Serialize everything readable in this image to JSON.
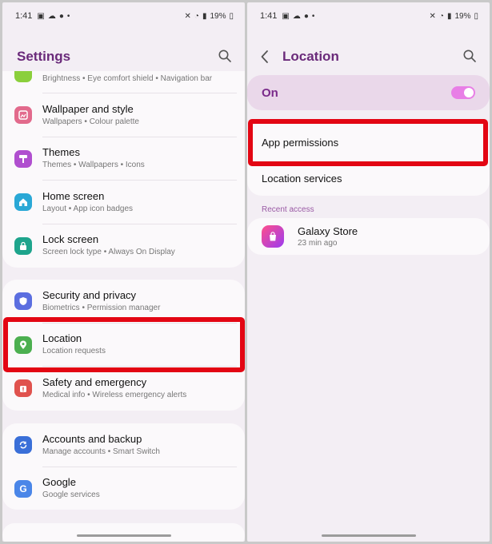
{
  "status": {
    "time": "1:41",
    "battery": "19%"
  },
  "left": {
    "title": "Settings",
    "partial_item": {
      "sub": "Brightness  •  Eye comfort shield  •  Navigation bar"
    },
    "group1": [
      {
        "label": "Wallpaper and style",
        "sub": "Wallpapers  •  Colour palette",
        "icon": "wallpaper-icon",
        "color": "#e26a8c"
      },
      {
        "label": "Themes",
        "sub": "Themes  •  Wallpapers  •  Icons",
        "icon": "themes-icon",
        "color": "#b04fcf"
      },
      {
        "label": "Home screen",
        "sub": "Layout  •  App icon badges",
        "icon": "home-icon",
        "color": "#2aa8d6"
      },
      {
        "label": "Lock screen",
        "sub": "Screen lock type  •  Always On Display",
        "icon": "lock-icon",
        "color": "#1ea48c"
      }
    ],
    "group2": [
      {
        "label": "Security and privacy",
        "sub": "Biometrics  •  Permission manager",
        "icon": "shield-icon",
        "color": "#5b6ee0"
      },
      {
        "label": "Location",
        "sub": "Location requests",
        "icon": "location-pin-icon",
        "color": "#4caf50"
      },
      {
        "label": "Safety and emergency",
        "sub": "Medical info  •  Wireless emergency alerts",
        "icon": "emergency-icon",
        "color": "#e0524e"
      }
    ],
    "group3": [
      {
        "label": "Accounts and backup",
        "sub": "Manage accounts  •  Smart Switch",
        "icon": "sync-icon",
        "color": "#3a6fd8"
      },
      {
        "label": "Google",
        "sub": "Google services",
        "icon": "google-icon",
        "color": "#4a86e8"
      }
    ]
  },
  "right": {
    "title": "Location",
    "toggle_label": "On",
    "toggle_state": "on",
    "app_permissions": "App permissions",
    "location_services": "Location services",
    "recent_access_label": "Recent access",
    "recent_app": {
      "name": "Galaxy Store",
      "time": "23 min ago",
      "icon": "galaxy-store-icon"
    }
  },
  "colors": {
    "accent": "#6a2a7a",
    "highlight": "#e30613",
    "toggle": "#e87fe6"
  }
}
